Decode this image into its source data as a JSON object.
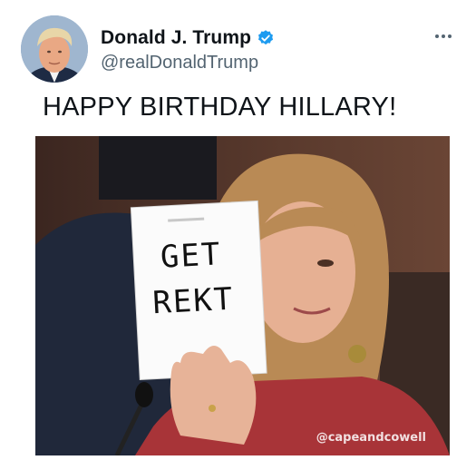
{
  "tweet": {
    "author": {
      "display_name": "Donald J. Trump",
      "handle": "@realDonaldTrump",
      "verified_icon": "verified-badge-icon"
    },
    "more_icon": "more-options-icon",
    "text": "HAPPY BIRTHDAY HILLARY!",
    "media": {
      "card_line1": "GET",
      "card_line2": "REKT",
      "watermark": "@capeandcowell"
    }
  },
  "colors": {
    "verified": "#1d9bf0",
    "text_primary": "#0f1419",
    "text_secondary": "#536471"
  }
}
